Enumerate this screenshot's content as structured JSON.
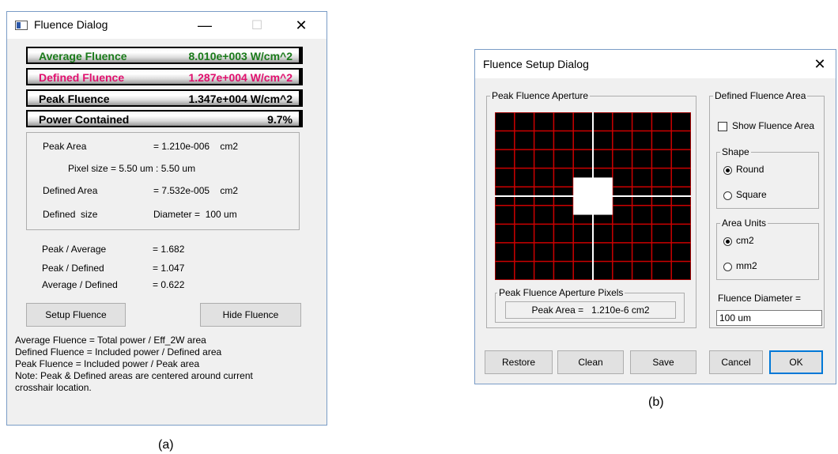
{
  "captions": {
    "a": "(a)",
    "b": "(b)"
  },
  "fluence_dialog": {
    "title": "Fluence Dialog",
    "controls": {
      "minimize": "—",
      "maximize": "☐",
      "close": "✕"
    },
    "bars": [
      {
        "label": "Average Fluence",
        "value": "8.010e+003 W/cm^2",
        "color": "#1a7a1a"
      },
      {
        "label": "Defined Fluence",
        "value": "1.287e+004 W/cm^2",
        "color": "#e0106e"
      },
      {
        "label": "Peak Fluence",
        "value": "1.347e+004 W/cm^2",
        "color": "#000000"
      },
      {
        "label": "Power Contained",
        "value": "9.7%",
        "color": "#000000"
      }
    ],
    "info": {
      "peak_area_label": "Peak Area",
      "peak_area_value": "= 1.210e-006    cm2",
      "pixel_size": "Pixel size = 5.50 um : 5.50 um",
      "defined_area_label": "Defined Area",
      "defined_area_value": "= 7.532e-005    cm2",
      "defined_size_label": "Defined  size",
      "defined_size_value": "Diameter =  100 um"
    },
    "ratios": [
      {
        "label": "Peak / Average",
        "value": "= 1.682"
      },
      {
        "label": "Peak / Defined",
        "value": "= 1.047"
      },
      {
        "label": "Average / Defined",
        "value": "= 0.622"
      }
    ],
    "buttons": {
      "setup": "Setup Fluence",
      "hide": "Hide Fluence"
    },
    "notes": [
      "Average Fluence = Total power / Eff_2W area",
      "Defined Fluence = Included power / Defined area",
      "Peak Fluence = Included power / Peak area",
      "Note: Peak & Defined areas are centered around current",
      "crosshair location."
    ]
  },
  "setup_dialog": {
    "title": "Fluence Setup Dialog",
    "close": "✕",
    "aperture_group": "Peak Fluence Aperture",
    "aperture_pixels_group": "Peak Fluence Aperture Pixels",
    "peak_area_text": "Peak Area =   1.210e-6 cm2",
    "defined_area_group": "Defined Fluence Area",
    "show_fluence_area": "Show Fluence Area",
    "shape_group": "Shape",
    "shape_options": [
      "Round",
      "Square"
    ],
    "shape_selected": "Round",
    "units_group": "Area Units",
    "unit_options": [
      "cm2",
      "mm2"
    ],
    "unit_selected": "cm2",
    "diameter_label": "Fluence Diameter =",
    "diameter_value": "100 um",
    "buttons": {
      "restore": "Restore",
      "clean": "Clean",
      "save": "Save",
      "cancel": "Cancel",
      "ok": "OK"
    },
    "grid_colors": {
      "background": "#000000",
      "lines": "#cc0000",
      "center": "#ffffff"
    }
  }
}
